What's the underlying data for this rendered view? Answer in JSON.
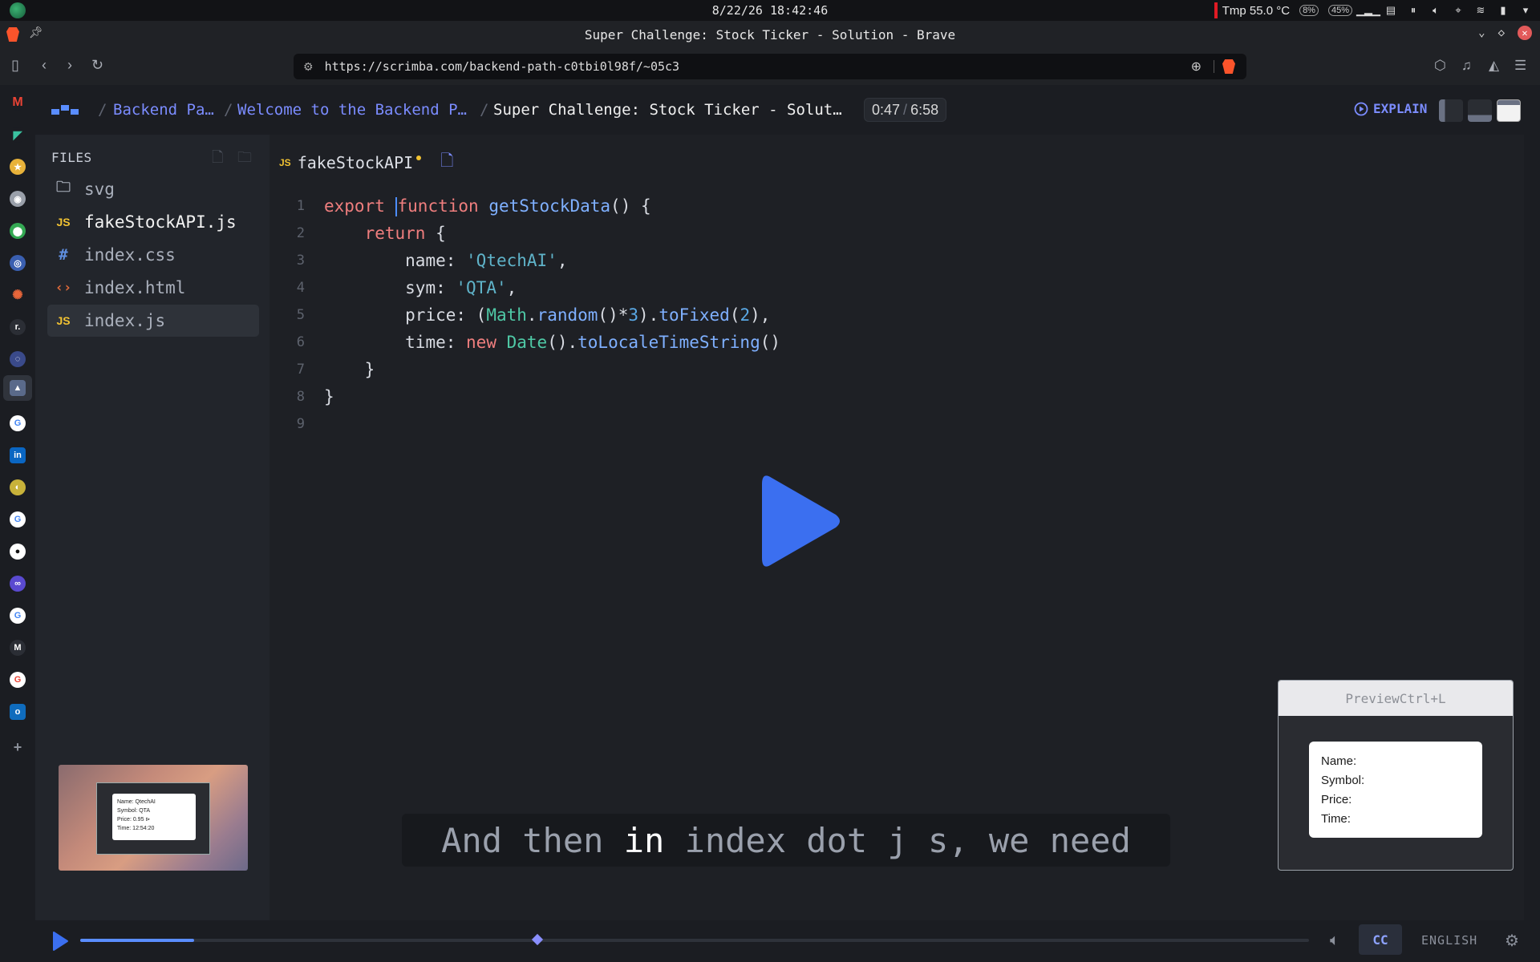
{
  "system_bar": {
    "clock": "8/22/26 18:42:46",
    "temp": "Tmp 55.0 °C",
    "cpu": "8%",
    "mem": "45%"
  },
  "browser": {
    "window_title": "Super Challenge: Stock Ticker - Solution - Brave",
    "url": "https://scrimba.com/backend-path-c0tbi0l98f/~05c3"
  },
  "breadcrumb": {
    "items": [
      "Backend Pa…",
      "Welcome to the Backend P…"
    ],
    "current": "Super Challenge: Stock Ticker - Solut…"
  },
  "playback": {
    "current_time": "0:47",
    "total_time": "6:58",
    "progress_fraction": 0.093,
    "marker_fraction": 0.372
  },
  "header": {
    "explain_label": "EXPLAIN"
  },
  "files": {
    "header": "FILES",
    "items": [
      {
        "name": "svg",
        "type": "folder"
      },
      {
        "name": "fakeStockAPI.js",
        "type": "js"
      },
      {
        "name": "index.css",
        "type": "css"
      },
      {
        "name": "index.html",
        "type": "html"
      },
      {
        "name": "index.js",
        "type": "js"
      }
    ]
  },
  "editor": {
    "tab_label": "fakeStockAPI",
    "tab_badge": "JS"
  },
  "thumbnail": {
    "name": "Name: QtechAI",
    "symbol": "Symbol: QTA",
    "price": "Price: 0.95 ⊳",
    "time": "Time: 12:54:20"
  },
  "caption": {
    "before": "And then ",
    "highlight": "in",
    "after": " index dot j s, we need"
  },
  "preview": {
    "title": "PreviewCtrl+L",
    "name": "Name:",
    "symbol": "Symbol:",
    "price": "Price:",
    "time": "Time:"
  },
  "player": {
    "cc_label": "CC",
    "language": "ENGLISH"
  },
  "colors": {
    "accent": "#7b8cff",
    "play": "#3b6ff0",
    "keyword": "#ef7e7e",
    "string": "#5fb3c9"
  }
}
